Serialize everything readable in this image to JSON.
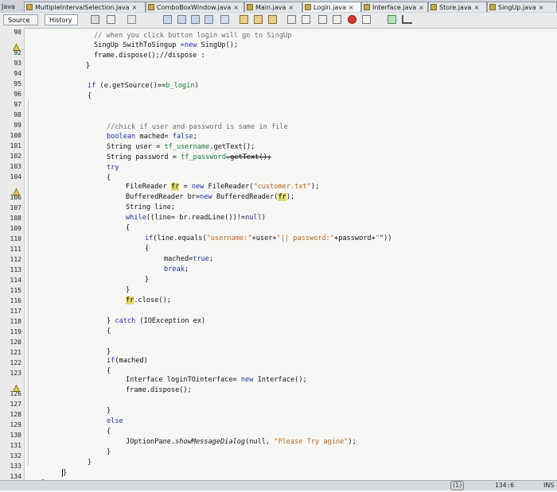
{
  "tabs": [
    {
      "label": "Java"
    },
    {
      "label": "MultipleIntervalSelection.java",
      "close": "×"
    },
    {
      "label": "ComboBoxWindow.java",
      "close": "×"
    },
    {
      "label": "Main.java",
      "close": "×"
    },
    {
      "label": "Login.java",
      "close": "×"
    },
    {
      "label": "Interface.java",
      "close": "×"
    },
    {
      "label": "Store.java",
      "close": "×"
    },
    {
      "label": "SingUp.java",
      "close": "×"
    }
  ],
  "toolbar": {
    "source_label": "Source",
    "history_label": "History"
  },
  "line_numbers": [
    "90",
    "91",
    "92",
    "93",
    "94",
    "95",
    "96",
    "97",
    "98",
    "99",
    "100",
    "101",
    "102",
    "103",
    "104",
    "105",
    "106",
    "107",
    "108",
    "109",
    "110",
    "111",
    "112",
    "113",
    "114",
    "115",
    "116",
    "117",
    "118",
    "119",
    "120",
    "121",
    "122",
    "123",
    "124",
    "125",
    "126",
    "127",
    "128",
    "129",
    "130",
    "131",
    "132",
    "133",
    "134",
    "135"
  ],
  "code": {
    "l90a": "// when you click button login will go to SingUp",
    "l91a": "SingUp SwithToSingup ",
    "l91b": "=new",
    "l91c": " SingUp();",
    "l92a": "frame.dispose();//dispose :",
    "l93a": "}",
    "l95a": "if",
    "l95b": " (e.getSource()==",
    "l95c": "b_login",
    "l95d": ")",
    "l96a": "{",
    "l99a": "//chick if user and password is same in file",
    "l100a": "boolean",
    "l100b": " mached= ",
    "l100c": "false",
    "l100d": ";",
    "l101a": "String user = ",
    "l101b": "tf_username",
    "l101c": ".getText();",
    "l102a": "String password = ",
    "l102b": "tf_password",
    "l102c": ".getText();",
    "l103a": "try",
    "l104a": "{",
    "l105a": "FileReader ",
    "l105b": "fr",
    "l105c": " = ",
    "l105d": "new",
    "l105e": " FileReader(",
    "l105f": "\"customer.txt\"",
    "l105g": ");",
    "l106a": "BufferedReader br=",
    "l106b": "new",
    "l106c": " BufferedReader(",
    "l106d": "fr",
    "l106e": ");",
    "l107a": "String line;",
    "l108a": "while",
    "l108b": "((line= br.readLine())!=",
    "l108c": "null",
    "l108d": ")",
    "l109a": "{",
    "l110a": "if",
    "l110b": "(line.equals(",
    "l110c": "\"username:\"",
    "l110d": "+user+",
    "l110e": "\"|| password:\"",
    "l110f": "+password+",
    "l110g": "\"",
    "l110h": "\"))",
    "l111a": "{",
    "l112a": "mached=",
    "l112b": "true",
    "l112c": ";",
    "l113a": "break",
    "l113b": ";",
    "l114a": "}",
    "l115a": "}",
    "l116a": "fr",
    "l116b": ".close();",
    "l119a": "} ",
    "l119b": "catch",
    "l119c": " (IOException ex)",
    "l120a": "{",
    "l122a": "}",
    "l123a": "if",
    "l123b": "(mached)",
    "l124a": "{",
    "l125a": "Interface loginTOinterface= ",
    "l125b": "new",
    "l125c": " Interface();",
    "l126a": "frame.dispose();",
    "l128a": "}",
    "l129a": "else",
    "l130a": "{",
    "l131a": "JOptionPane.",
    "l131b": "showMessageDialog",
    "l131c": "(null, ",
    "l131d": "\"Please Try agine\"",
    "l131e": ");",
    "l132a": "}",
    "l133a": "}",
    "l134a": "}",
    "l135a": "}"
  },
  "status": {
    "position": "134:6",
    "mode": "INS",
    "notifications": "(1)"
  }
}
